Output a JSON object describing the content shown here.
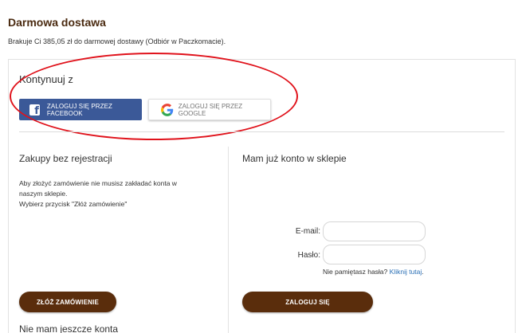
{
  "shipping": {
    "title": "Darmowa dostawa",
    "info": "Brakuje Ci 385,05 zł do darmowej dostawy (Odbiór w Paczkomacie)."
  },
  "social": {
    "heading": "Kontynuuj z",
    "facebook_label": "ZALOGUJ SIĘ PRZEZ FACEBOOK",
    "google_label": "ZALOGUJ SIĘ PRZEZ GOOGLE"
  },
  "guest": {
    "title": "Zakupy bez rejestracji",
    "line1": "Aby złożyć zamówienie nie musisz zakładać konta w",
    "line2": "naszym sklepie.",
    "line3": "Wybierz przycisk \"Złóż zamówienie\"",
    "order_button": "ZŁÓŻ ZAMÓWIENIE"
  },
  "account": {
    "title": "Mam już konto w sklepie",
    "email_label": "E-mail:",
    "password_label": "Hasło:",
    "forgot_text": "Nie pamiętasz hasła?",
    "forgot_link": "Kliknij tutaj",
    "forgot_suffix": ".",
    "login_button": "ZALOGUJ SIĘ"
  },
  "no_account": {
    "title": "Nie mam jeszcze konta"
  },
  "colors": {
    "brand_brown": "#5a2d0c",
    "title_brown": "#4a2a10",
    "facebook_blue": "#3b5998",
    "annotation_red": "#e0121b",
    "link_blue": "#2a6fb5"
  }
}
